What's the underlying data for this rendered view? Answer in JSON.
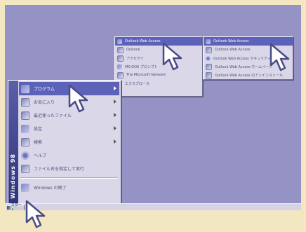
{
  "start_menu": {
    "banner": "Windows 98",
    "items": [
      {
        "label": "プログラム",
        "icon": "programs-icon",
        "selected": true,
        "arrow": true
      },
      {
        "label": "お気に入り",
        "icon": "favorites-icon",
        "arrow": true
      },
      {
        "label": "最近使ったファイル",
        "icon": "documents-icon",
        "arrow": true
      },
      {
        "label": "設定",
        "icon": "settings-icon",
        "arrow": true
      },
      {
        "label": "検索",
        "icon": "find-icon",
        "arrow": true
      },
      {
        "label": "ヘルプ",
        "icon": "help-icon"
      },
      {
        "label": "ファイル名を指定して実行",
        "icon": "run-icon"
      },
      {
        "label": "Windows の終了",
        "icon": "shutdown-icon"
      }
    ]
  },
  "programs_menu": {
    "items": [
      {
        "label": "Outlook Web Access",
        "icon": "program-group-icon",
        "selected": true
      },
      {
        "label": "Outlook",
        "icon": "app-icon"
      },
      {
        "label": "アクセサリ",
        "icon": "app-icon"
      },
      {
        "label": "MS-DOS プロンプト",
        "icon": "app-icon"
      },
      {
        "label": "The Microsoft Network",
        "icon": "app-icon"
      },
      {
        "label": "エクスプローラ",
        "icon": "app-icon"
      }
    ]
  },
  "owa_menu": {
    "items": [
      {
        "label": "Outlook Web Access",
        "icon": "app-icon",
        "selected": true
      },
      {
        "label": "Outlook Web Access",
        "icon": "app-icon"
      },
      {
        "label": "Outlook Web Access セキュリティ",
        "icon": "app-icon"
      },
      {
        "label": "Outlook Web Access ホームページ",
        "icon": "app-icon"
      },
      {
        "label": "Outlook Web Access のアンインストール",
        "icon": "app-icon"
      }
    ]
  },
  "taskbar": {
    "start_label": "スタート"
  }
}
